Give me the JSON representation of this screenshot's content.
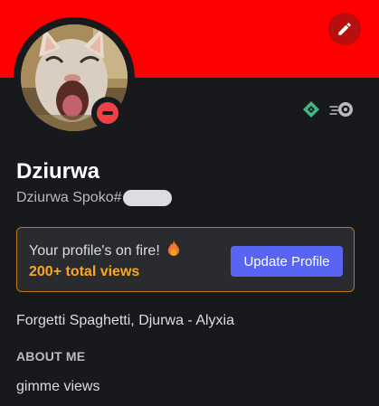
{
  "profile": {
    "display_name": "Dziurwa",
    "username_prefix": "Dziurwa Spoko#",
    "status": "dnd",
    "status_color": "#ed4245",
    "banner_color": "#ff0000",
    "custom_status": "Forgetti Spaghetti, Djurwa - Alyxia"
  },
  "badges": [
    {
      "name": "hypesquad-balance-icon",
      "color": "#43b581"
    },
    {
      "name": "nitro-boost-icon",
      "color": "#b9bbbe"
    }
  ],
  "promo": {
    "message": "Your profile's on fire!",
    "views": "200+ total views",
    "button_label": "Update Profile",
    "accent_color": "#faa81a",
    "button_color": "#5865f2"
  },
  "about": {
    "header": "ABOUT ME",
    "text": "gimme views"
  },
  "icons": {
    "edit": "pencil-icon",
    "fire": "fire-icon",
    "status": "do-not-disturb-icon"
  }
}
